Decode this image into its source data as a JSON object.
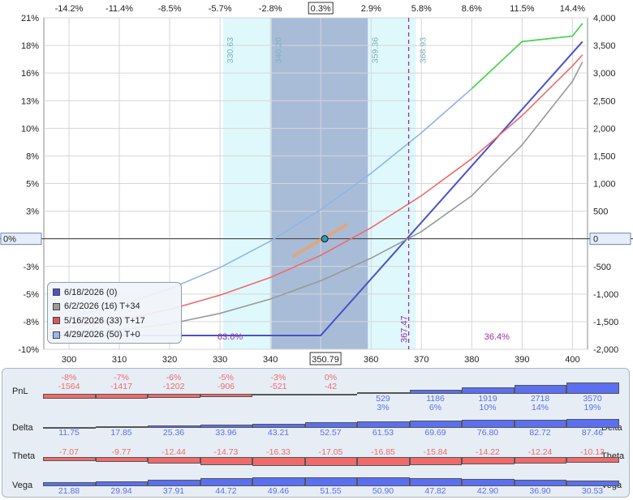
{
  "chart_data": {
    "type": "line",
    "x_ticks": [
      "300",
      "310",
      "320",
      "330",
      "340",
      "350",
      "360",
      "370",
      "380",
      "390",
      "400"
    ],
    "top_pct_ticks": [
      "-14.2%",
      "-11.4%",
      "-8.5%",
      "-5.7%",
      "-2.8%",
      "0.3%",
      "2.9%",
      "5.8%",
      "8.6%",
      "11.5%",
      "14.4%"
    ],
    "left_y_ticks": [
      "21%",
      "18%",
      "16%",
      "13%",
      "10%",
      "8%",
      "5%",
      "3%",
      "0%",
      "-3%",
      "-5%",
      "-8%",
      "-10%"
    ],
    "right_y_ticks": [
      "4,000",
      "3,500",
      "3,000",
      "2,500",
      "2,000",
      "1,500",
      "1,000",
      "500",
      "0",
      "-500",
      "-1,000",
      "-1,500",
      "-2,000"
    ],
    "xlim": [
      295,
      403
    ],
    "ylim_right": [
      -2000,
      4000
    ],
    "current_price_label": "350.79",
    "current_price": 350.79,
    "vertical_lines": [
      {
        "x": 330.63,
        "label": "330.63"
      },
      {
        "x": 340.2,
        "label": "340.20"
      },
      {
        "x": 359.36,
        "label": "359.36"
      },
      {
        "x": 368.93,
        "label": "368.93"
      }
    ],
    "breakeven": {
      "x": 367.47,
      "label": "367.47"
    },
    "prob_labels": [
      {
        "text": "63.6%",
        "x": 332
      },
      {
        "text": "36.4%",
        "x": 385
      }
    ],
    "series": [
      {
        "name": "6/18/2026 (0)",
        "color": "#4a52c8",
        "x": [
          296,
          350,
          402
        ],
        "y": [
          -1750,
          -1750,
          3570
        ]
      },
      {
        "name": "6/2/2026 (16) T+34",
        "color": "#999999",
        "x": [
          296,
          300,
          310,
          320,
          330,
          340,
          350,
          360,
          370,
          380,
          390,
          400,
          402
        ],
        "y": [
          -1700,
          -1700,
          -1650,
          -1540,
          -1350,
          -1090,
          -760,
          -350,
          130,
          780,
          1700,
          2850,
          3200
        ]
      },
      {
        "name": "5/16/2026 (33) T+17",
        "color": "#f06a6a",
        "x": [
          296,
          300,
          310,
          320,
          330,
          340,
          350,
          360,
          370,
          380,
          390,
          400,
          402
        ],
        "y": [
          -1640,
          -1600,
          -1470,
          -1280,
          -1020,
          -700,
          -300,
          200,
          780,
          1450,
          2230,
          3130,
          3330
        ]
      },
      {
        "name": "4/29/2026 (50) T+0",
        "color": "#8fb4ea",
        "x": [
          296,
          300,
          310,
          320,
          330,
          340,
          350,
          360,
          370,
          380,
          390,
          400,
          402
        ],
        "y": [
          -1564,
          -1417,
          -1202,
          -906,
          -521,
          -42,
          529,
          1186,
          1919,
          2718,
          3570,
          3670,
          3900
        ]
      }
    ]
  },
  "legend": [
    {
      "label": "6/18/2026 (0)",
      "color": "#4a52c8"
    },
    {
      "label": "6/2/2026 (16) T+34",
      "color": "#9a9a9a"
    },
    {
      "label": "5/16/2026 (33) T+17",
      "color": "#e05555"
    },
    {
      "label": "4/29/2026 (50) T+0",
      "color": "#9ab8e8"
    }
  ],
  "greeks": {
    "labels": {
      "pnl": "PnL",
      "delta": "Delta",
      "theta": "Theta",
      "vega": "Vega"
    },
    "pnl_pct": [
      "-8%",
      "-7%",
      "-6%",
      "-5%",
      "-3%",
      "0%",
      "3%",
      "6%",
      "10%",
      "14%",
      "19%"
    ],
    "pnl": [
      "-1564",
      "-1417",
      "-1202",
      "-906",
      "-521",
      "-42",
      "529",
      "1186",
      "1919",
      "2718",
      "3570"
    ],
    "pnl_values": [
      -1564,
      -1417,
      -1202,
      -906,
      -521,
      -42,
      529,
      1186,
      1919,
      2718,
      3570
    ],
    "delta": [
      "11.75",
      "17.85",
      "25.36",
      "33.96",
      "43.21",
      "52.57",
      "61.53",
      "69.69",
      "76.80",
      "82.72",
      "87.46"
    ],
    "delta_values": [
      11.75,
      17.85,
      25.36,
      33.96,
      43.21,
      52.57,
      61.53,
      69.69,
      76.8,
      82.72,
      87.46
    ],
    "theta": [
      "-7.07",
      "-9.77",
      "-12.44",
      "-14.73",
      "-16.33",
      "-17.05",
      "-16.85",
      "-15.84",
      "-14.22",
      "-12.24",
      "-10.13"
    ],
    "theta_values": [
      -7.07,
      -9.77,
      -12.44,
      -14.73,
      -16.33,
      -17.05,
      -16.85,
      -15.84,
      -14.22,
      -12.24,
      -10.13
    ],
    "vega": [
      "21.88",
      "29.94",
      "37.91",
      "44.72",
      "49.46",
      "51.55",
      "50.90",
      "47.82",
      "42.90",
      "36.90",
      "30.53"
    ],
    "vega_values": [
      21.88,
      29.94,
      37.91,
      44.72,
      49.46,
      51.55,
      50.9,
      47.82,
      42.9,
      36.9,
      30.53
    ]
  },
  "colors": {
    "positive": "#5b6ff0",
    "negative": "#ef6b6b",
    "band_light": "#dff8fb",
    "band_dark": "#a8bcd8",
    "breakeven": "#9a2fa0",
    "prob_text": "#9a2fa0"
  }
}
